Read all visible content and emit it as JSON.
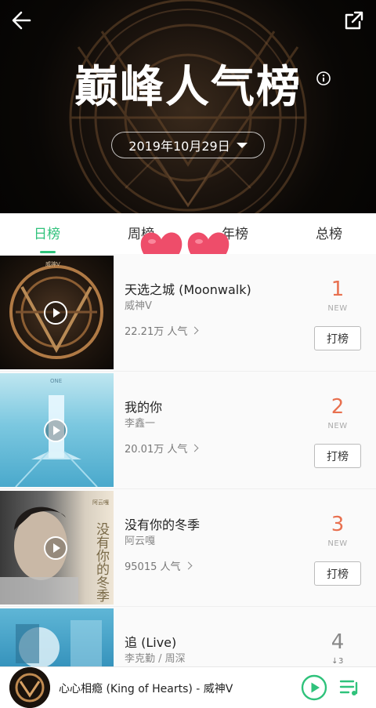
{
  "header": {
    "title": "巅峰人气榜",
    "date": "2019年10月29日"
  },
  "tabs": [
    {
      "label": "日榜",
      "active": true
    },
    {
      "label": "周榜",
      "active": false
    },
    {
      "label": "年榜",
      "active": false
    },
    {
      "label": "总榜",
      "active": false
    }
  ],
  "songs": [
    {
      "title": "天选之城 (Moonwalk)",
      "artist": "威神V",
      "popularity": "22.21万 人气",
      "rank": "1",
      "rank_sub": "NEW",
      "action": "打榜"
    },
    {
      "title": "我的你",
      "artist": "李鑫一",
      "popularity": "20.01万 人气",
      "rank": "2",
      "rank_sub": "NEW",
      "action": "打榜"
    },
    {
      "title": "没有你的冬季",
      "artist": "阿云嘎",
      "popularity": "95015 人气",
      "rank": "3",
      "rank_sub": "NEW",
      "action": "打榜"
    },
    {
      "title": "追 (Live)",
      "artist": "李克勤 / 周深",
      "popularity": "",
      "rank": "4",
      "rank_sub": "↓3",
      "action": ""
    }
  ],
  "cover_texts": {
    "cover1_small": "威神V",
    "cover2_small": "ONE",
    "cover3_text": "没有你的冬季",
    "cover3_small": "阿云嘎"
  },
  "player": {
    "now_playing": "心心相瘾 (King of Hearts) - 威神V"
  },
  "colors": {
    "accent": "#2fc27b",
    "rank": "#e8704f"
  }
}
